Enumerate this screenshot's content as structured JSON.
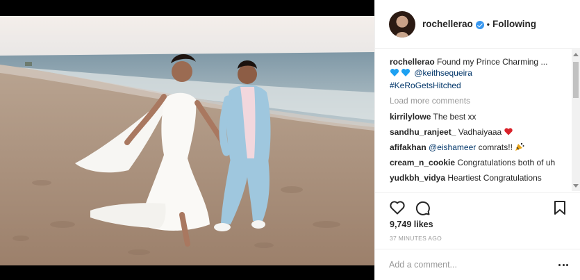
{
  "post": {
    "photo_alt": "Bride and groom walking on the beach",
    "author": {
      "username": "rochellerao",
      "verified": true,
      "follow_state": "Following"
    }
  },
  "caption": {
    "username": "rochellerao",
    "text": "Found my Prince Charming ...",
    "mention": "@keithsequeira",
    "hashtag": "#KeRoGetsHitched"
  },
  "load_more": "Load more comments",
  "comments": [
    {
      "username": "kirrilylowe",
      "text": "The best xx"
    },
    {
      "username": "sandhu_ranjeet_",
      "text": "Vadhaiyaaa"
    },
    {
      "username": "afifakhan",
      "mention": "@eishameer",
      "text": "comrats!!"
    },
    {
      "username": "cream_n_cookie",
      "text": "Congratulations both of uh"
    },
    {
      "username": "yudkbh_vidya",
      "text": "Heartiest Congratulations"
    }
  ],
  "likes": "9,749 likes",
  "timestamp": "37 MINUTES AGO",
  "add_comment_placeholder": "Add a comment...",
  "icons": {
    "like": "heart-outline-icon",
    "comment": "comment-bubble-icon",
    "save": "bookmark-icon",
    "more": "ellipsis-icon",
    "verified": "verified-badge-icon"
  },
  "colors": {
    "verified": "#3897f0",
    "link": "#003569",
    "muted": "#999999",
    "heart_red": "#d9222a",
    "heart_blue": "#1da1f2"
  }
}
